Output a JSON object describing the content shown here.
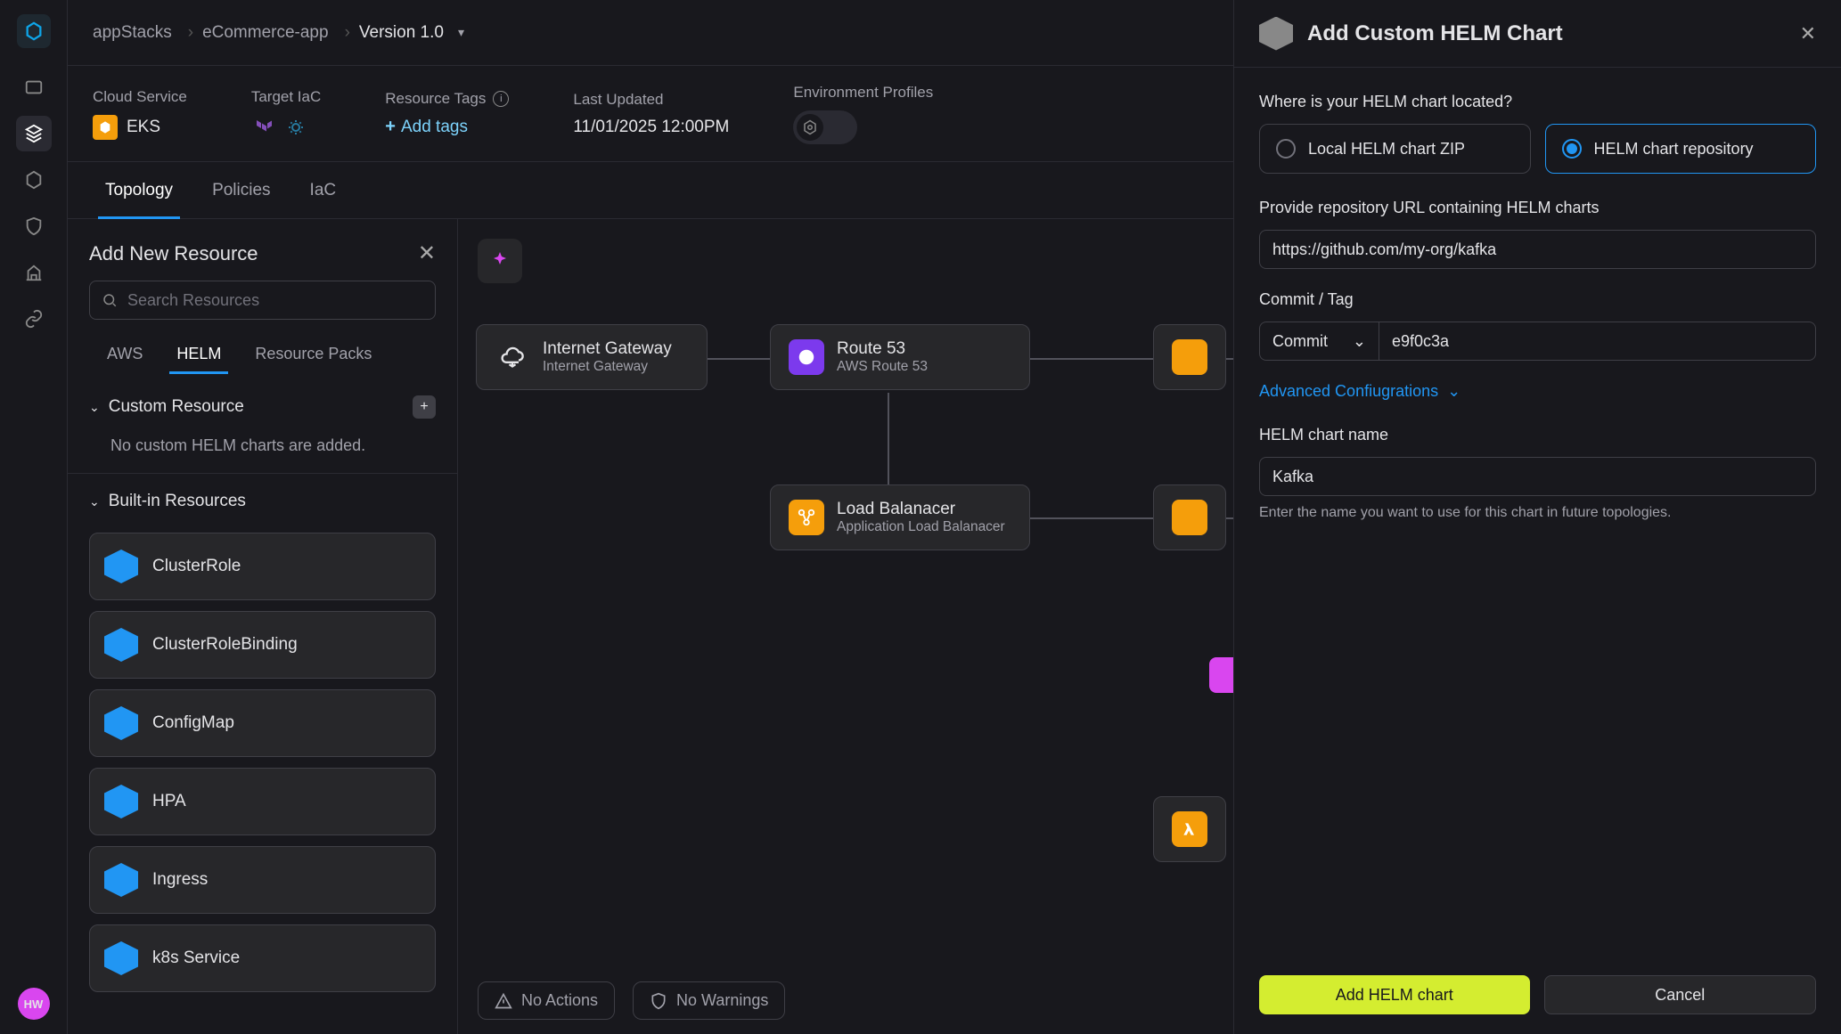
{
  "breadcrumb": {
    "root": "appStacks",
    "app": "eCommerce-app",
    "version": "Version 1.0"
  },
  "infoBar": {
    "cloudService": {
      "label": "Cloud Service",
      "value": "EKS"
    },
    "targetIac": {
      "label": "Target IaC"
    },
    "resourceTags": {
      "label": "Resource Tags",
      "cta": "Add tags"
    },
    "lastUpdated": {
      "label": "Last Updated",
      "value": "11/01/2025 12:00PM"
    },
    "envProfiles": {
      "label": "Environment Profiles"
    }
  },
  "tabs": {
    "topology": "Topology",
    "policies": "Policies",
    "iac": "IaC"
  },
  "leftPanel": {
    "title": "Add New Resource",
    "searchPlaceholder": "Search Resources",
    "subTabs": {
      "aws": "AWS",
      "helm": "HELM",
      "packs": "Resource Packs"
    },
    "customSection": {
      "title": "Custom Resource",
      "empty": "No custom HELM charts are added."
    },
    "builtinSection": {
      "title": "Built-in Resources"
    },
    "resources": [
      "ClusterRole",
      "ClusterRoleBinding",
      "ConfigMap",
      "HPA",
      "Ingress",
      "k8s Service"
    ]
  },
  "nodes": {
    "ig": {
      "title": "Internet Gateway",
      "sub": "Internet Gateway"
    },
    "r53": {
      "title": "Route 53",
      "sub": "AWS Route 53"
    },
    "lb": {
      "title": "Load Balanacer",
      "sub": "Application Load Balanacer"
    }
  },
  "statusBar": {
    "actions": "No Actions",
    "warnings": "No Warnings"
  },
  "sidePanel": {
    "title": "Add Custom HELM Chart",
    "locationLabel": "Where is your HELM chart located?",
    "optLocal": "Local HELM chart ZIP",
    "optRepo": "HELM chart repository",
    "repoUrlLabel": "Provide repository URL containing HELM charts",
    "repoUrlValue": "https://github.com/my-org/kafka",
    "commitLabel": "Commit / Tag",
    "commitSelect": "Commit",
    "commitValue": "e9f0c3a",
    "advanced": "Advanced Confiugrations",
    "nameLabel": "HELM chart name",
    "nameValue": "Kafka",
    "nameHelp": "Enter the name you want to use for this chart in future topologies.",
    "btnAdd": "Add HELM chart",
    "btnCancel": "Cancel"
  },
  "avatar": "HW"
}
